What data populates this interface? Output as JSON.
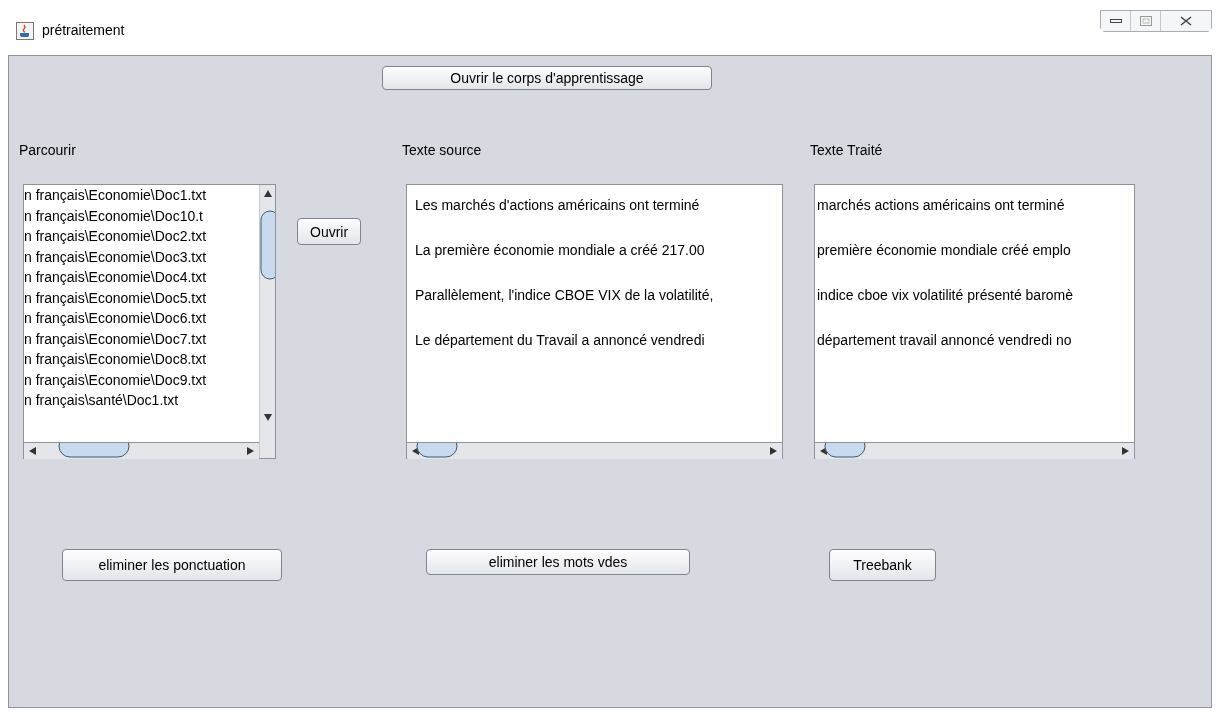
{
  "window": {
    "title": "prétraitement"
  },
  "open_corpus_button": "Ouvrir le corps d'apprentissage",
  "columns": [
    {
      "label": "Parcourir"
    },
    {
      "label": "Texte source"
    },
    {
      "label": "Texte Traité"
    }
  ],
  "file_list": {
    "items": [
      {
        "text": "n français\\Economie\\Doc1.txt",
        "selected": false
      },
      {
        "text": "n français\\Economie\\Doc10.t",
        "selected": false
      },
      {
        "text": "n français\\Economie\\Doc2.txt",
        "selected": false
      },
      {
        "text": "n français\\Economie\\Doc3.txt",
        "selected": false
      },
      {
        "text": "n français\\Economie\\Doc4.txt",
        "selected": false
      },
      {
        "text": "n français\\Economie\\Doc5.txt",
        "selected": false
      },
      {
        "text": "n français\\Economie\\Doc6.txt",
        "selected": false
      },
      {
        "text": "n français\\Economie\\Doc7.txt",
        "selected": false
      },
      {
        "text": "n français\\Economie\\Doc8.txt",
        "selected": false
      },
      {
        "text": "n français\\Economie\\Doc9.txt",
        "selected": false
      },
      {
        "text": "n français\\santé\\Doc1.txt",
        "selected": false
      }
    ]
  },
  "open_button": "Ouvrir",
  "source_text": [
    "Les marchés d'actions américains ont terminé",
    "La première économie mondiale a créé 217.00",
    "Parallèlement, l'indice CBOE VIX de la volatilité,",
    "Le département du Travail a annoncé vendredi"
  ],
  "processed_text": [
    "marchés actions américains ont terminé",
    "première économie mondiale créé emplo",
    "indice cboe vix volatilité présenté baromè",
    "département travail annoncé vendredi no"
  ],
  "bottom_buttons": [
    "eliminer les ponctuation",
    "eliminer les mots vdes",
    "Treebank"
  ]
}
